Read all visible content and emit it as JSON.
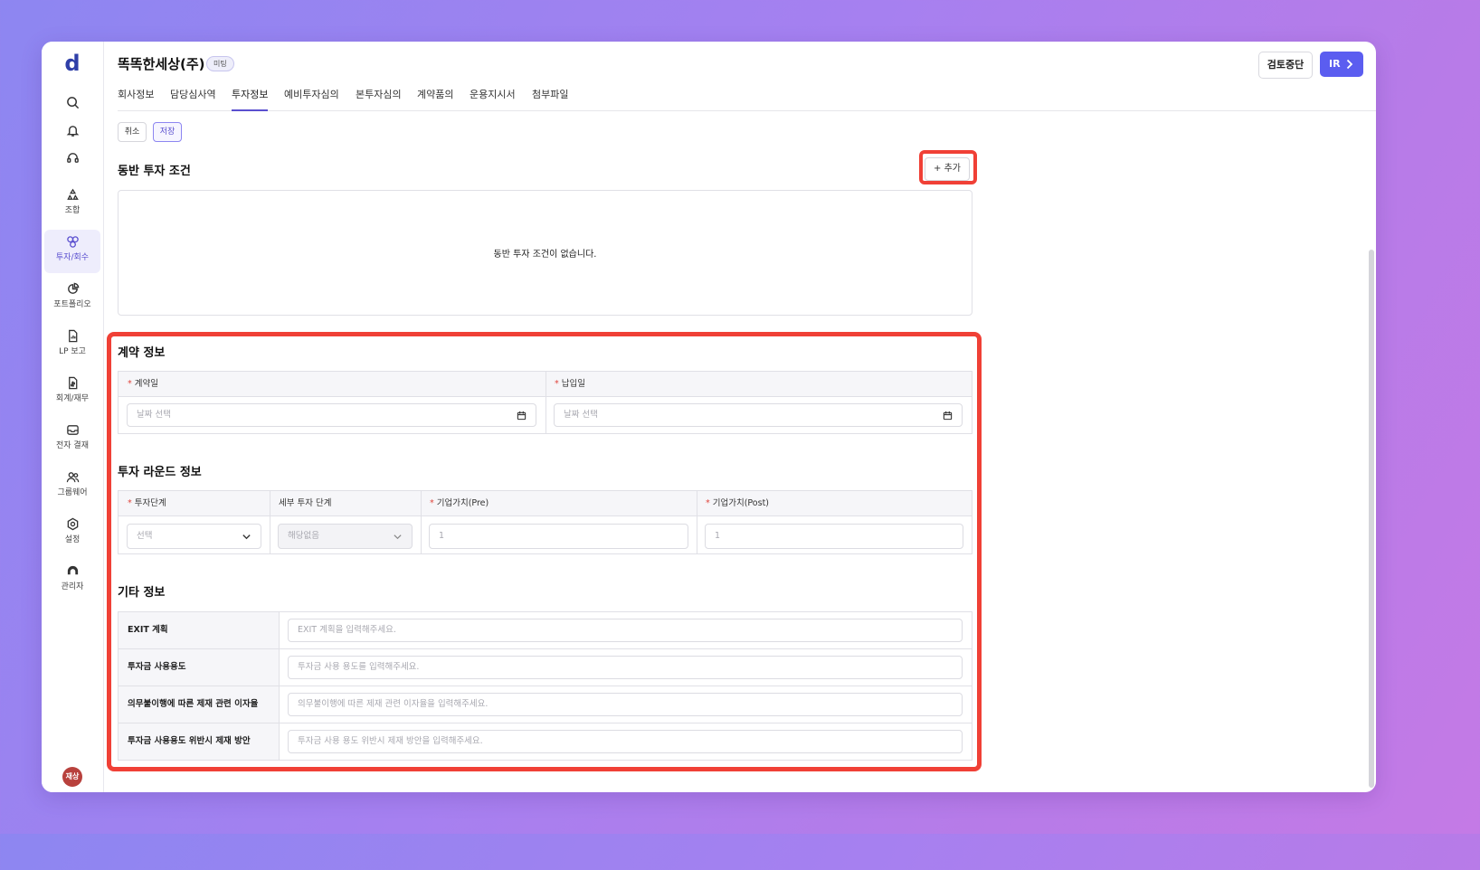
{
  "sidebar": {
    "logo": "d",
    "nav": [
      {
        "label": "조합",
        "icon": "recycle-icon"
      },
      {
        "label": "투자/회수",
        "icon": "investment-icon"
      },
      {
        "label": "포트폴리오",
        "icon": "pie-chart-icon"
      },
      {
        "label": "LP 보고",
        "icon": "report-icon"
      },
      {
        "label": "회계/재무",
        "icon": "finance-icon"
      },
      {
        "label": "전자 결재",
        "icon": "inbox-icon"
      },
      {
        "label": "그룹웨어",
        "icon": "users-icon"
      },
      {
        "label": "설정",
        "icon": "settings-icon"
      },
      {
        "label": "관리자",
        "icon": "admin-icon"
      }
    ],
    "avatar": "재상"
  },
  "header": {
    "company": "똑똑한세상(주)",
    "badge": "미팅",
    "stop_label": "검토중단",
    "ir_label": "IR"
  },
  "tabs": [
    "회사정보",
    "담당심사역",
    "투자정보",
    "예비투자심의",
    "본투자심의",
    "계약품의",
    "운용지시서",
    "첨부파일"
  ],
  "active_tab": "투자정보",
  "actions": {
    "cancel": "취소",
    "save": "저장"
  },
  "co_invest": {
    "title": "동반 투자 조건",
    "add_label": "+ 추가",
    "empty": "동반 투자 조건이 없습니다."
  },
  "contract": {
    "title": "계약 정보",
    "contract_date_label": "계약일",
    "payment_date_label": "납입일",
    "date_placeholder": "날짜 선택"
  },
  "round": {
    "title": "투자 라운드 정보",
    "stage_label": "투자단계",
    "detail_label": "세부 투자 단계",
    "pre_label": "기업가치(Pre)",
    "post_label": "기업가치(Post)",
    "stage_value": "선택",
    "detail_value": "해당없음",
    "pre_value": "1",
    "post_value": "1"
  },
  "other": {
    "title": "기타 정보",
    "rows": [
      {
        "label": "EXIT 계획",
        "placeholder": "EXIT 계획을 입력해주세요."
      },
      {
        "label": "투자금 사용용도",
        "placeholder": "투자금 사용 용도를 입력해주세요."
      },
      {
        "label": "의무불이행에 따른 제재 관련 이자율",
        "placeholder": "의무불이행에 따른 제재 관련 이자율을 입력해주세요."
      },
      {
        "label": "투자금 사용용도 위반시 제재 방안",
        "placeholder": "투자금 사용 용도 위반시 제재 방안을 입력해주세요."
      }
    ]
  }
}
